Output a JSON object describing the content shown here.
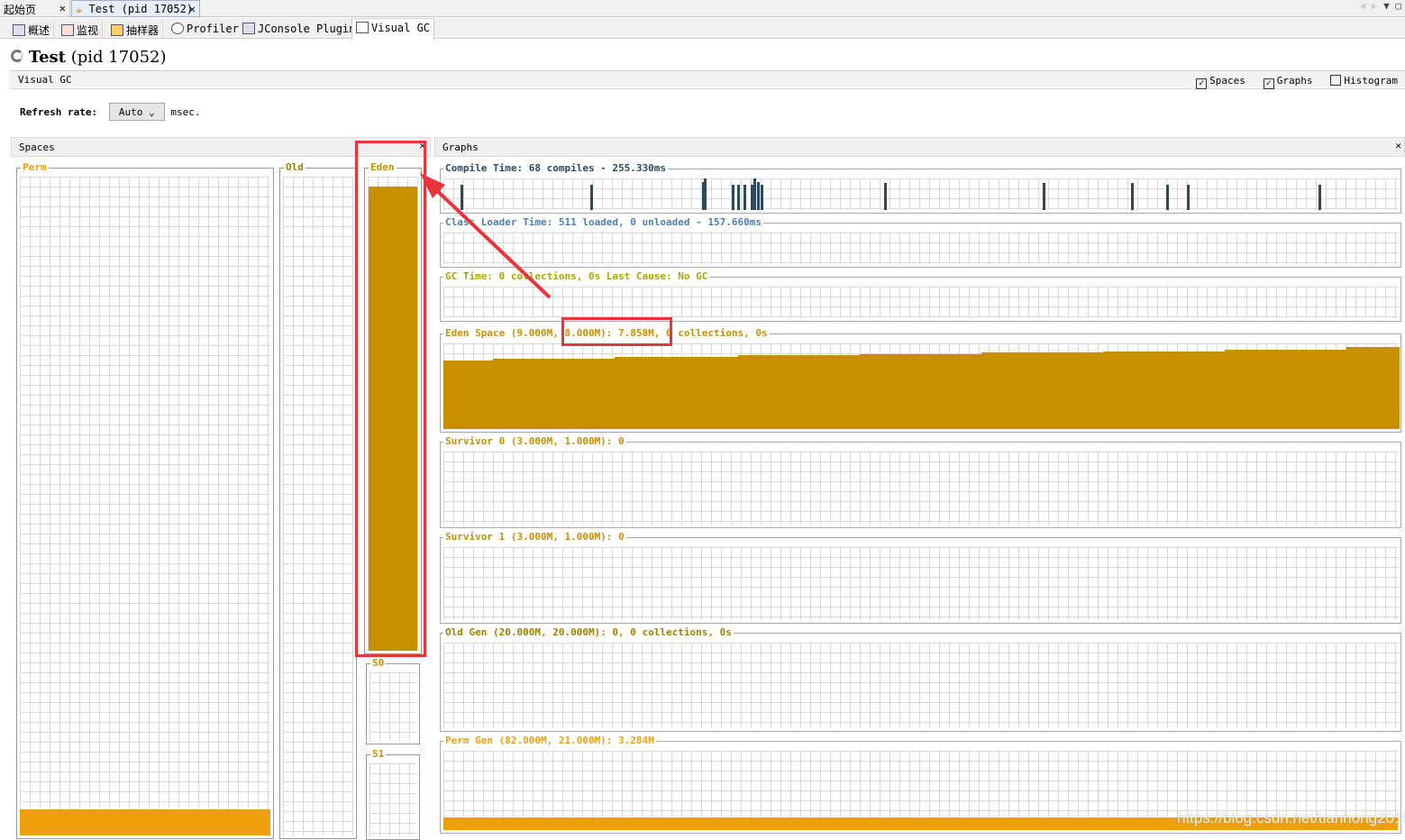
{
  "tabs": [
    {
      "label": "起始页",
      "close": "✕"
    },
    {
      "label": "Test (pid 17052)",
      "close": "✕",
      "active": true
    }
  ],
  "subtabs": [
    {
      "label": "概述",
      "icon": "overview-icon"
    },
    {
      "label": "监视",
      "icon": "monitor-icon"
    },
    {
      "label": "抽样器",
      "icon": "sampler-icon"
    },
    {
      "label": "Profiler",
      "icon": "profiler-icon"
    },
    {
      "label": "JConsole Plugins",
      "icon": "jconsole-icon"
    },
    {
      "label": "Visual GC",
      "icon": "visualgc-icon",
      "active": true
    }
  ],
  "title": "Test",
  "title_pid": "(pid 17052)",
  "section": "Visual GC",
  "options": {
    "spaces": {
      "label": "Spaces",
      "checked": true
    },
    "graphs": {
      "label": "Graphs",
      "checked": true
    },
    "histogram": {
      "label": "Histogram",
      "checked": false
    }
  },
  "refresh": {
    "label": "Refresh rate:",
    "value": "Auto",
    "unit": "msec."
  },
  "spaces": {
    "title": "Spaces",
    "close": "✕",
    "perm": {
      "label": "Perm",
      "used_fraction": 0.04
    },
    "old": {
      "label": "Old",
      "used_fraction": 0
    },
    "eden": {
      "label": "Eden",
      "used_fraction": 0.98
    },
    "s0": {
      "label": "S0",
      "used_fraction": 0
    },
    "s1": {
      "label": "S1",
      "used_fraction": 0
    }
  },
  "graphs": {
    "title": "Graphs",
    "close": "✕",
    "compile": "Compile Time: 68 compiles - 255.330ms",
    "classloader": "Class Loader Time: 511 loaded, 0 unloaded - 157.660ms",
    "gc": "GC Time: 0 collections, 0s Last Cause: No GC",
    "eden": "Eden Space (9.000M, 8.000M): 7.858M, 0 collections, 0s",
    "s0": "Survivor 0 (3.000M, 1.000M): 0",
    "s1": "Survivor 1 (3.000M, 1.000M): 0",
    "old": "Old Gen (20.000M, 20.000M): 0, 0 collections, 0s",
    "perm": "Perm Gen (82.000M, 21.000M): 3.284M"
  },
  "colors": {
    "compile": "#2b4a5e",
    "classloader": "#4f7fae",
    "gc": "#a8a800",
    "memory": "#c89000",
    "perm_fill": "#ee9f0c",
    "annotation": "#e8343a"
  },
  "watermark": "https://blog.csdn.net/tianhong2015"
}
